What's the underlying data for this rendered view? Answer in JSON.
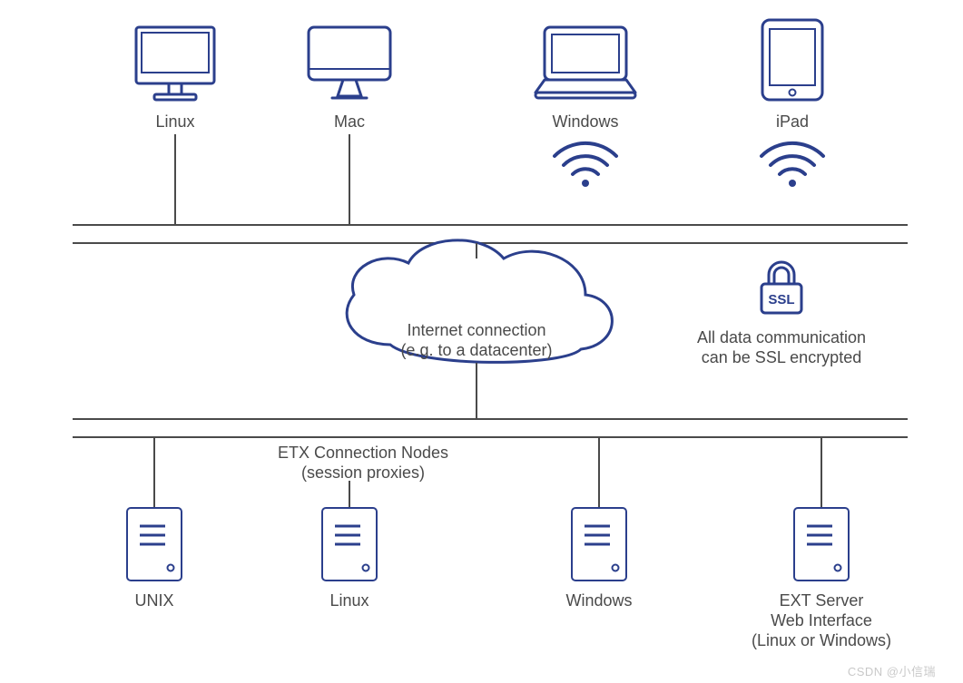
{
  "clients": {
    "linux": {
      "label": "Linux"
    },
    "mac": {
      "label": "Mac"
    },
    "windows": {
      "label": "Windows"
    },
    "ipad": {
      "label": "iPad"
    }
  },
  "cloud": {
    "line1": "Internet connection",
    "line2": "(e.g. to a datacenter)"
  },
  "ssl": {
    "badge": "SSL",
    "line1": "All data communication",
    "line2": "can be SSL encrypted"
  },
  "connection_nodes": {
    "line1": "ETX Connection Nodes",
    "line2": "(session proxies)"
  },
  "servers": {
    "unix": {
      "label": "UNIX"
    },
    "linux": {
      "label": "Linux"
    },
    "windows": {
      "label": "Windows"
    },
    "ext": {
      "label_l1": "EXT Server",
      "label_l2": "Web Interface",
      "label_l3": "(Linux or Windows)"
    }
  },
  "watermark": "CSDN @小信瑞"
}
